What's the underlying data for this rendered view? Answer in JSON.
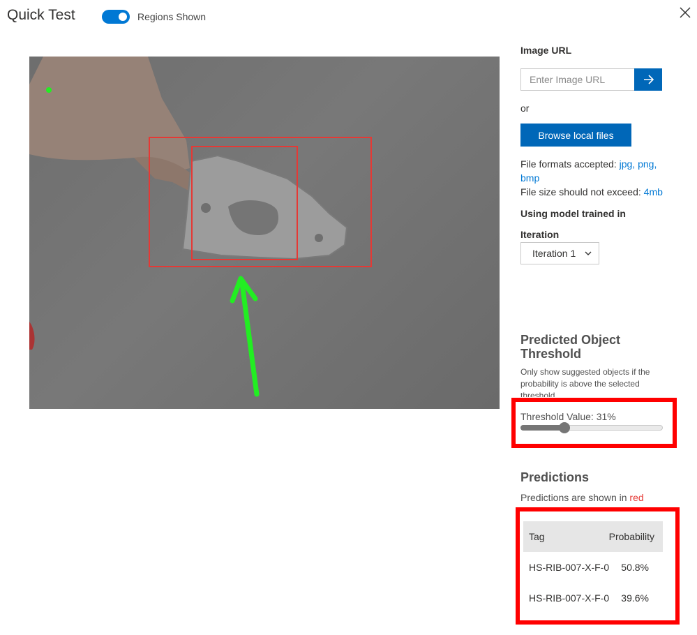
{
  "header": {
    "title": "Quick Test",
    "toggle_label": "Regions Shown",
    "toggle_on": true
  },
  "right_panel": {
    "image_url_label": "Image URL",
    "image_url_placeholder": "Enter Image URL",
    "or_text": "or",
    "browse_label": "Browse local files",
    "formats_prefix": "File formats accepted:",
    "formats_links": [
      "jpg,",
      "png,",
      "bmp"
    ],
    "size_prefix": "File size should not exceed:",
    "size_value": "4mb",
    "model_label": "Using model trained in",
    "iteration_label": "Iteration",
    "iteration_value": "Iteration 1",
    "threshold_title": "Predicted Object Threshold",
    "threshold_desc": "Only show suggested objects if the probability is above the selected threshold",
    "threshold_label": "Threshold Value: 31%",
    "threshold_value_pct": 31,
    "predictions_title": "Predictions",
    "predictions_desc_prefix": "Predictions are shown in",
    "predictions_desc_color_word": "red",
    "table": {
      "headers": [
        "Tag",
        "Probability"
      ],
      "rows": [
        {
          "tag": "HS-RIB-007-X-F-0",
          "prob": "50.8%"
        },
        {
          "tag": "HS-RIB-007-X-F-0",
          "prob": "39.6%"
        }
      ]
    }
  },
  "colors": {
    "accent": "#0078d4",
    "button": "#0067b8",
    "prediction_box": "#e53935",
    "highlight": "#ff0000",
    "annotation_arrow": "#22ee22"
  },
  "icons": {
    "close": "close-icon",
    "url_submit": "arrow-right-icon",
    "select": "chevron-down-icon"
  }
}
